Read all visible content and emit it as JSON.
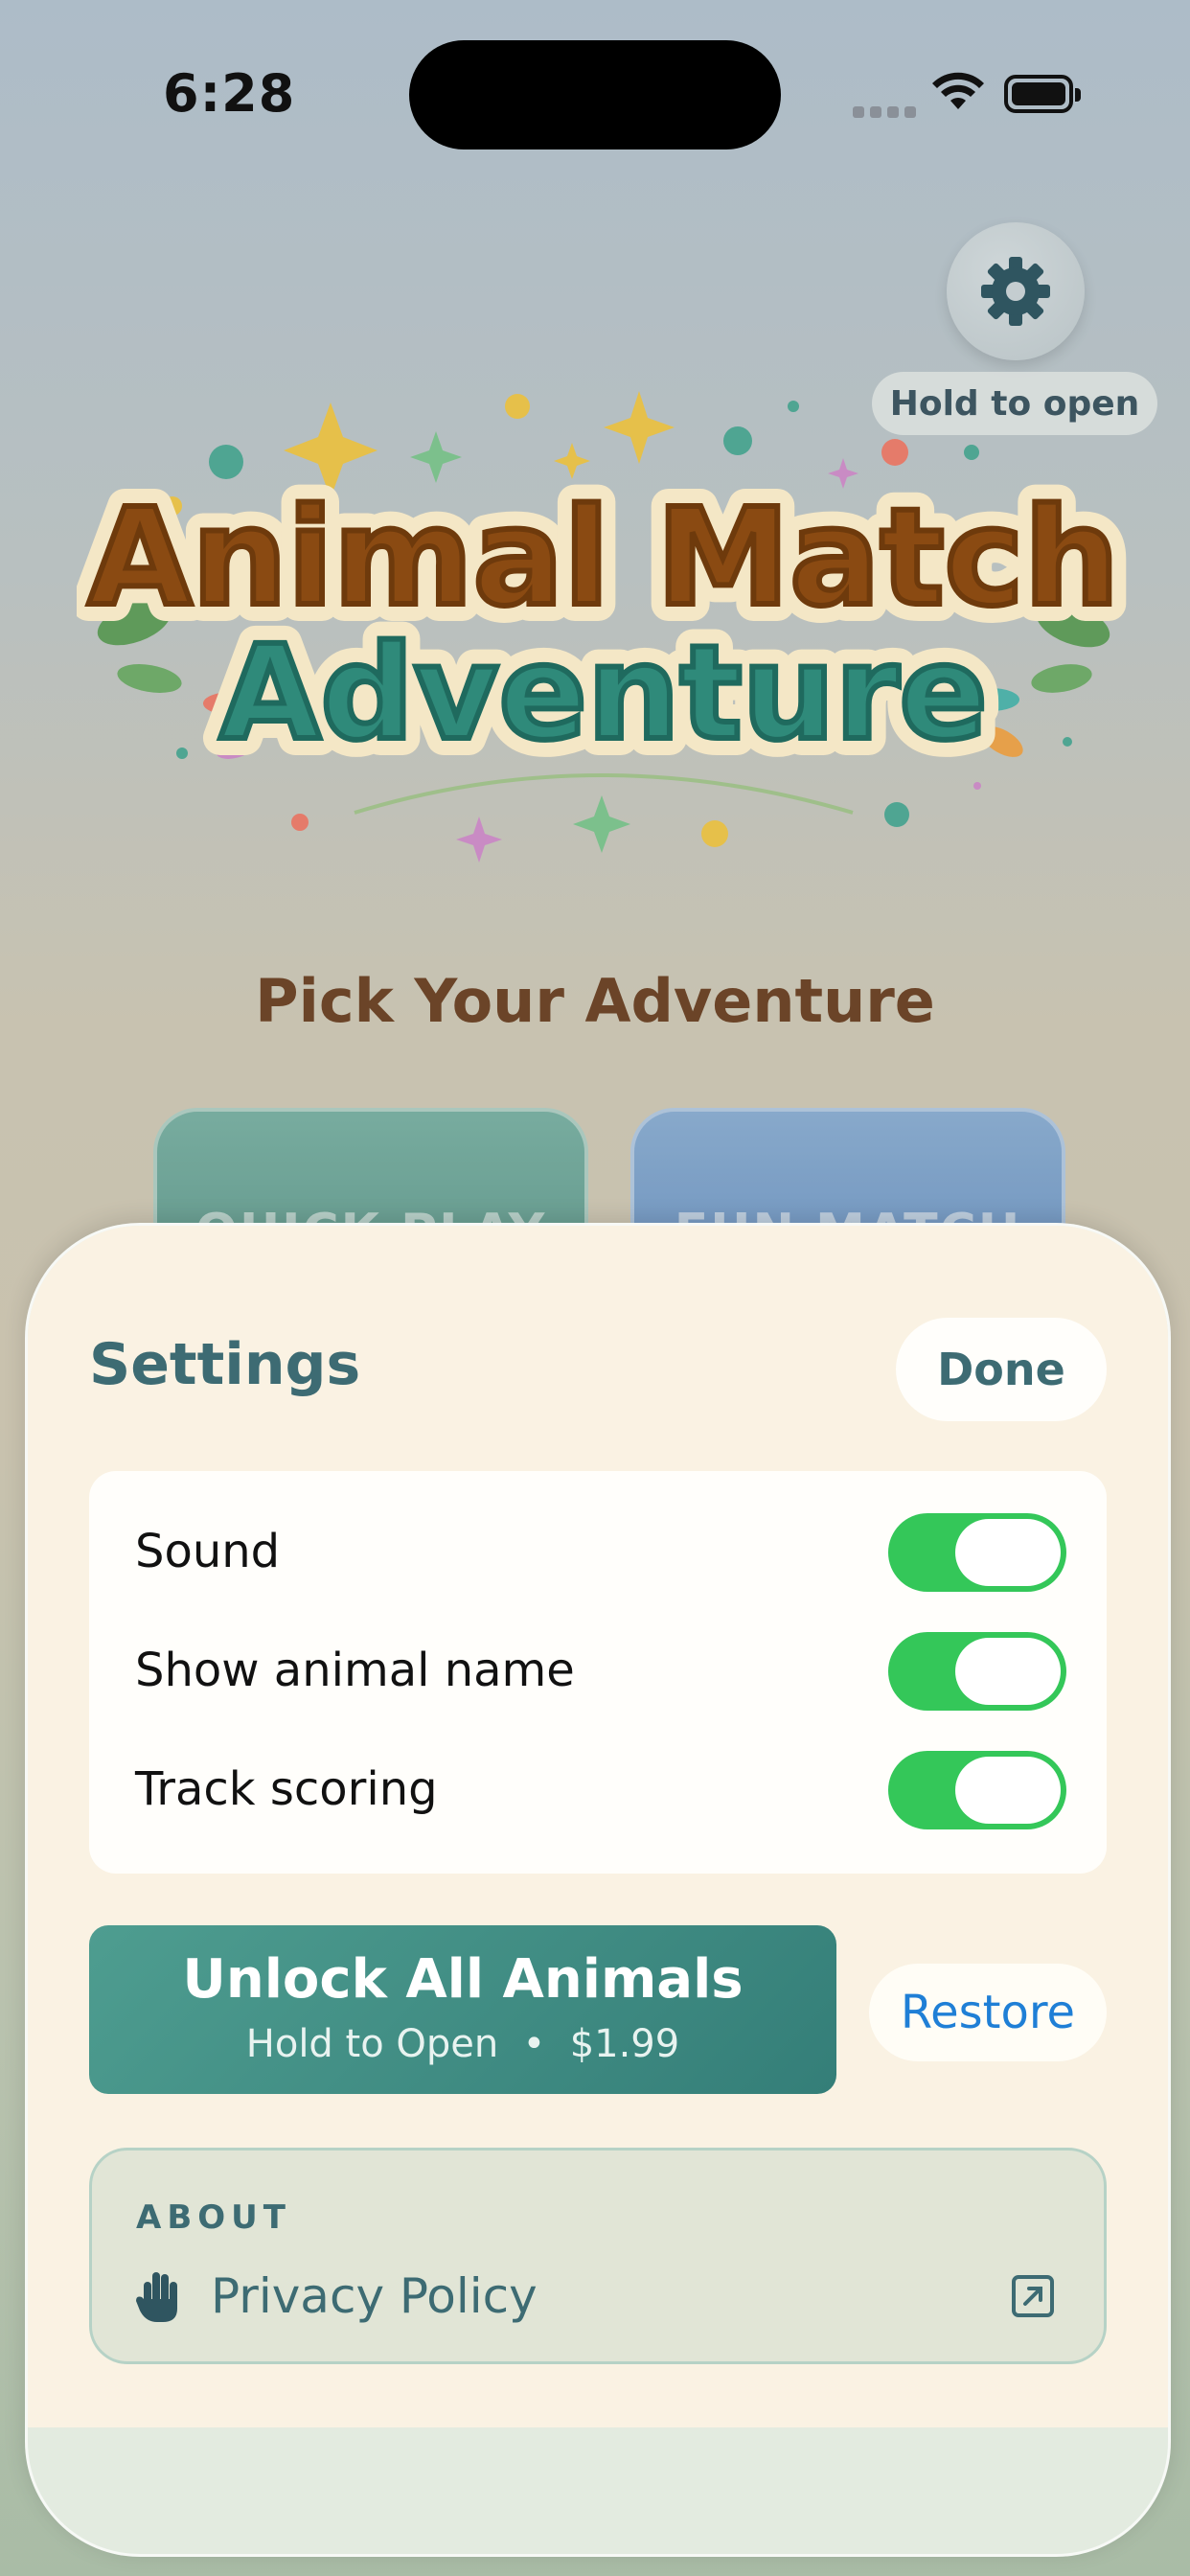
{
  "status_bar": {
    "time": "6:28"
  },
  "header": {
    "settings_hint": "Hold to open"
  },
  "logo": {
    "line1": "Animal Match",
    "line2": "Adventure"
  },
  "main": {
    "heading": "Pick Your Adventure",
    "modes": [
      {
        "label": "QUICK PLAY"
      },
      {
        "label": "FUN MATCH"
      }
    ]
  },
  "settings": {
    "title": "Settings",
    "done_label": "Done",
    "toggles": [
      {
        "label": "Sound",
        "on": true
      },
      {
        "label": "Show animal name",
        "on": true
      },
      {
        "label": "Track scoring",
        "on": true
      }
    ],
    "unlock": {
      "title": "Unlock All Animals",
      "subtitle": "Hold to Open  •  $1.99"
    },
    "restore_label": "Restore",
    "about": {
      "heading": "ABOUT",
      "privacy_label": "Privacy Policy"
    }
  },
  "colors": {
    "accent": "#3d6b73",
    "toggle_on": "#34c759",
    "link": "#1f7fd6",
    "unlock": "#4e9d90"
  }
}
